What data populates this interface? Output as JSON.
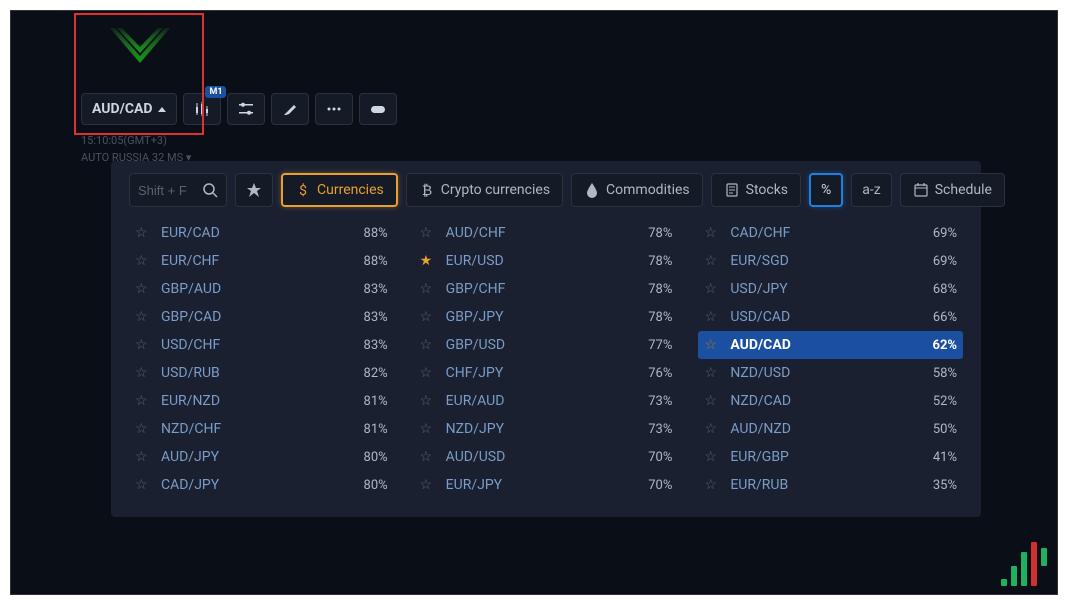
{
  "toolbar": {
    "symbol": "AUD/CAD",
    "badge": "M1"
  },
  "status": {
    "line1": "15:10:05(GMT+3)",
    "line2": "AUTO  RUSSIA    32 MS ▾"
  },
  "search": {
    "placeholder": "Shift + F"
  },
  "filters": {
    "currencies": "Currencies",
    "crypto": "Crypto currencies",
    "commodities": "Commodities",
    "stocks": "Stocks",
    "percent": "%",
    "az": "a-z",
    "schedule": "Schedule"
  },
  "columns": [
    [
      {
        "pair": "EUR/CAD",
        "pct": "88%",
        "fav": false
      },
      {
        "pair": "EUR/CHF",
        "pct": "88%",
        "fav": false
      },
      {
        "pair": "GBP/AUD",
        "pct": "83%",
        "fav": false
      },
      {
        "pair": "GBP/CAD",
        "pct": "83%",
        "fav": false
      },
      {
        "pair": "USD/CHF",
        "pct": "83%",
        "fav": false
      },
      {
        "pair": "USD/RUB",
        "pct": "82%",
        "fav": false
      },
      {
        "pair": "EUR/NZD",
        "pct": "81%",
        "fav": false
      },
      {
        "pair": "NZD/CHF",
        "pct": "81%",
        "fav": false
      },
      {
        "pair": "AUD/JPY",
        "pct": "80%",
        "fav": false
      },
      {
        "pair": "CAD/JPY",
        "pct": "80%",
        "fav": false
      }
    ],
    [
      {
        "pair": "AUD/CHF",
        "pct": "78%",
        "fav": false
      },
      {
        "pair": "EUR/USD",
        "pct": "78%",
        "fav": true
      },
      {
        "pair": "GBP/CHF",
        "pct": "78%",
        "fav": false
      },
      {
        "pair": "GBP/JPY",
        "pct": "78%",
        "fav": false
      },
      {
        "pair": "GBP/USD",
        "pct": "77%",
        "fav": false
      },
      {
        "pair": "CHF/JPY",
        "pct": "76%",
        "fav": false
      },
      {
        "pair": "EUR/AUD",
        "pct": "73%",
        "fav": false
      },
      {
        "pair": "NZD/JPY",
        "pct": "73%",
        "fav": false
      },
      {
        "pair": "AUD/USD",
        "pct": "70%",
        "fav": false
      },
      {
        "pair": "EUR/JPY",
        "pct": "70%",
        "fav": false
      }
    ],
    [
      {
        "pair": "CAD/CHF",
        "pct": "69%",
        "fav": false
      },
      {
        "pair": "EUR/SGD",
        "pct": "69%",
        "fav": false
      },
      {
        "pair": "USD/JPY",
        "pct": "68%",
        "fav": false
      },
      {
        "pair": "USD/CAD",
        "pct": "66%",
        "fav": false
      },
      {
        "pair": "AUD/CAD",
        "pct": "62%",
        "fav": false,
        "selected": true
      },
      {
        "pair": "NZD/USD",
        "pct": "58%",
        "fav": false
      },
      {
        "pair": "NZD/CAD",
        "pct": "52%",
        "fav": false
      },
      {
        "pair": "AUD/NZD",
        "pct": "50%",
        "fav": false
      },
      {
        "pair": "EUR/GBP",
        "pct": "41%",
        "fav": false
      },
      {
        "pair": "EUR/RUB",
        "pct": "35%",
        "fav": false
      }
    ]
  ]
}
